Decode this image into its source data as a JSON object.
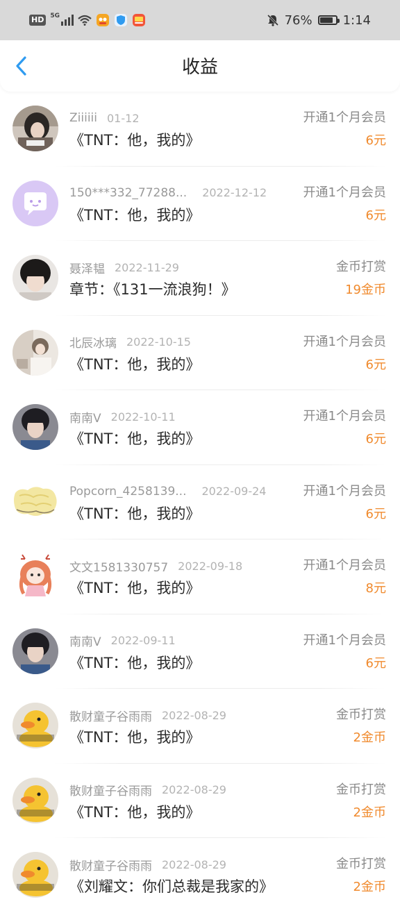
{
  "status_bar": {
    "network": "5G",
    "hd": "HD",
    "battery": "76%",
    "time": "1:14",
    "icons": [
      "signal-icon",
      "wifi-icon",
      "app-notification-icon",
      "shield-icon",
      "app-icon",
      "mute-bell-icon",
      "battery-icon"
    ]
  },
  "header": {
    "title": "收益",
    "back_icon": "chevron-left-icon"
  },
  "colors": {
    "accent_blue": "#2f9bf0",
    "amount_orange": "#f08a2d"
  },
  "records": [
    {
      "user": "Ziiiiii",
      "date": "01-12",
      "book": "《TNT：他，我的》",
      "type": "开通1个月会员",
      "amount": "6元"
    },
    {
      "user": "150***332_77288...",
      "date": "2022-12-12",
      "book": "《TNT：他，我的》",
      "type": "开通1个月会员",
      "amount": "6元"
    },
    {
      "user": "聂泽韫",
      "date": "2022-11-29",
      "book": "章节：《131一流浪狗！》",
      "type": "金币打赏",
      "amount": "19金币"
    },
    {
      "user": "北辰冰璃",
      "date": "2022-10-15",
      "book": "《TNT：他，我的》",
      "type": "开通1个月会员",
      "amount": "6元"
    },
    {
      "user": "南南V",
      "date": "2022-10-11",
      "book": "《TNT：他，我的》",
      "type": "开通1个月会员",
      "amount": "6元"
    },
    {
      "user": "Popcorn_4258139...",
      "date": "2022-09-24",
      "book": "《TNT：他，我的》",
      "type": "开通1个月会员",
      "amount": "6元"
    },
    {
      "user": "文文1581330757",
      "date": "2022-09-18",
      "book": "《TNT：他，我的》",
      "type": "开通1个月会员",
      "amount": "8元"
    },
    {
      "user": "南南V",
      "date": "2022-09-11",
      "book": "《TNT：他，我的》",
      "type": "开通1个月会员",
      "amount": "6元"
    },
    {
      "user": "散财童子谷雨雨",
      "date": "2022-08-29",
      "book": "《TNT：他，我的》",
      "type": "金币打赏",
      "amount": "2金币"
    },
    {
      "user": "散财童子谷雨雨",
      "date": "2022-08-29",
      "book": "《TNT：他，我的》",
      "type": "金币打赏",
      "amount": "2金币"
    },
    {
      "user": "散财童子谷雨雨",
      "date": "2022-08-29",
      "book": "《刘耀文：你们总裁是我家的》",
      "type": "金币打赏",
      "amount": "2金币"
    }
  ]
}
